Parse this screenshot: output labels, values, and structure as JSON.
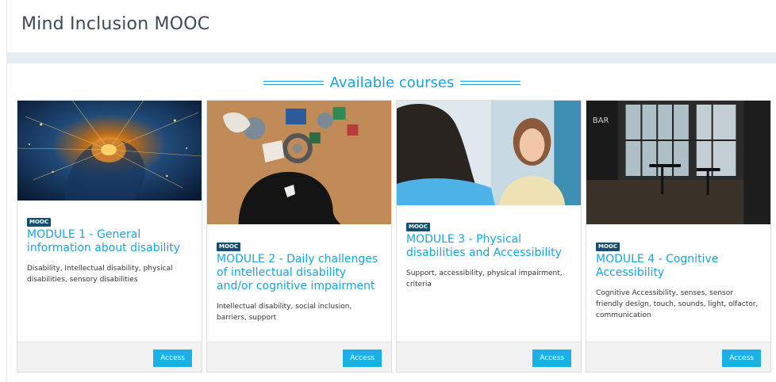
{
  "header": {
    "title": "Mind Inclusion MOOC"
  },
  "section": {
    "heading": "Available courses"
  },
  "courses": [
    {
      "badge": "MOOC",
      "title": "MODULE 1 - General information about disability",
      "tags": "Disability, Intellectual disability, physical disabilities, sensory disabilities",
      "action": "Access",
      "image": "glowing-brain-network"
    },
    {
      "badge": "MOOC",
      "title": "MODULE 2 - Daily challenges of intellectual disability and/or cognitive impairment",
      "tags": "Intellectual disability, social inclusion, barriers, support",
      "action": "Access",
      "image": "head-silhouette-puzzle-pieces"
    },
    {
      "badge": "MOOC",
      "title": "MODULE 3 - Physical disabilities and Accessibility",
      "tags": "Support, accessibility, physical impairment, criteria",
      "action": "Access",
      "image": "two-people-talking"
    },
    {
      "badge": "MOOC",
      "title": "MODULE 4 - Cognitive Accessibility",
      "tags": "Cognitive Accessibility, senses, sensor friendly design, touch, sounds, light, olfactor, communication",
      "action": "Access",
      "image": "cafe-interior"
    }
  ],
  "colors": {
    "accent": "#18a3d9",
    "button": "#1ab1e6",
    "badge": "#12506f",
    "band": "#e7eef3"
  }
}
